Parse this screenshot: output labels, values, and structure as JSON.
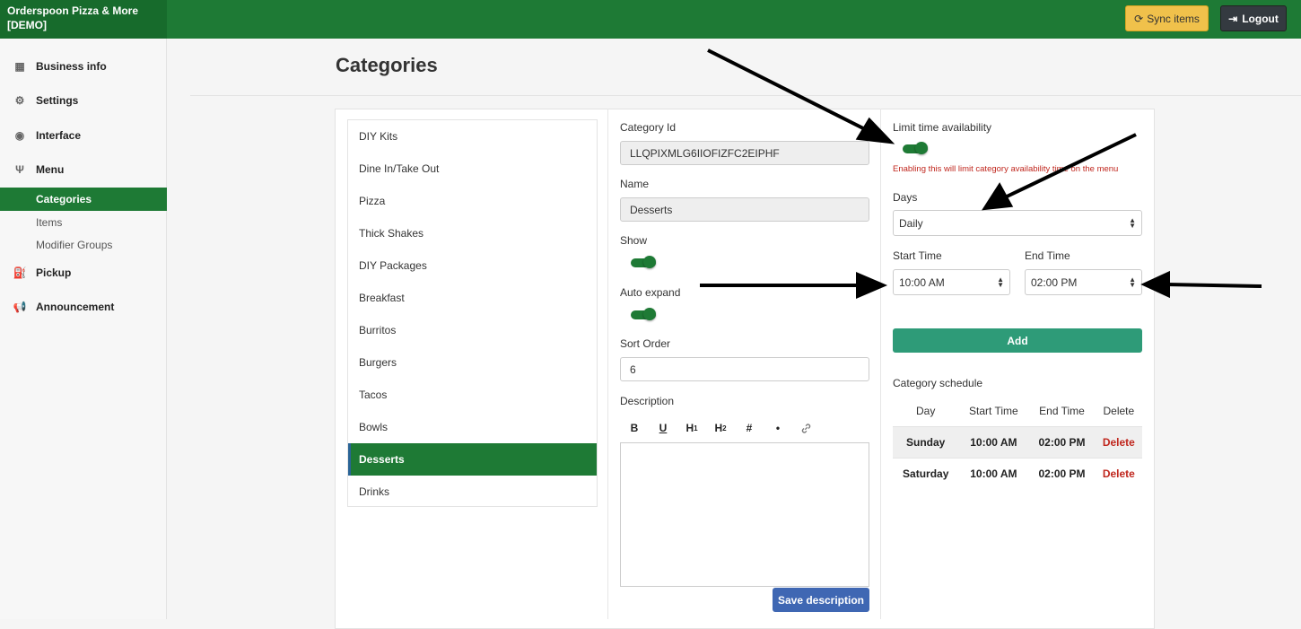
{
  "app": {
    "brand_line1": "Orderspoon Pizza & More",
    "brand_line2": "[DEMO]",
    "sync_label": "Sync items",
    "logout_label": "Logout"
  },
  "sidebar": {
    "business_info": "Business info",
    "settings": "Settings",
    "interface": "Interface",
    "menu": "Menu",
    "categories": "Categories",
    "items": "Items",
    "modifier_groups": "Modifier Groups",
    "pickup": "Pickup",
    "announcement": "Announcement"
  },
  "page": {
    "title": "Categories"
  },
  "categories": [
    "DIY Kits",
    "Dine In/Take Out",
    "Pizza",
    "Thick Shakes",
    "DIY Packages",
    "Breakfast",
    "Burritos",
    "Burgers",
    "Tacos",
    "Bowls",
    "Desserts",
    "Drinks"
  ],
  "selected_category": "Desserts",
  "form": {
    "category_id_label": "Category Id",
    "category_id_value": "LLQPIXMLG6IIOFIZFC2EIPHF",
    "name_label": "Name",
    "name_value": "Desserts",
    "show_label": "Show",
    "auto_expand_label": "Auto expand",
    "sort_order_label": "Sort Order",
    "sort_order_value": "6",
    "description_label": "Description",
    "toolbar": {
      "bold": "B",
      "underline": "U",
      "h1": "H",
      "h1_sub": "1",
      "h2": "H",
      "h2_sub": "2",
      "number": "#",
      "bullet": "•"
    },
    "save_label": "Save description"
  },
  "availability": {
    "limit_label": "Limit time availability",
    "warning": "Enabling this will limit category availability time on the menu",
    "days_label": "Days",
    "days_value": "Daily",
    "start_label": "Start Time",
    "start_value": "10:00 AM",
    "end_label": "End Time",
    "end_value": "02:00 PM",
    "add_label": "Add",
    "schedule_label": "Category schedule",
    "columns": [
      "Day",
      "Start Time",
      "End Time",
      "Delete"
    ],
    "rows": [
      {
        "day": "Sunday",
        "start": "10:00 AM",
        "end": "02:00 PM",
        "delete": "Delete"
      },
      {
        "day": "Saturday",
        "start": "10:00 AM",
        "end": "02:00 PM",
        "delete": "Delete"
      }
    ]
  },
  "colors": {
    "brand_green": "#1e7a35",
    "sync_yellow": "#f0c14b",
    "add_teal": "#2e9b78",
    "save_blue": "#3f67b3",
    "danger": "#c0271e"
  }
}
